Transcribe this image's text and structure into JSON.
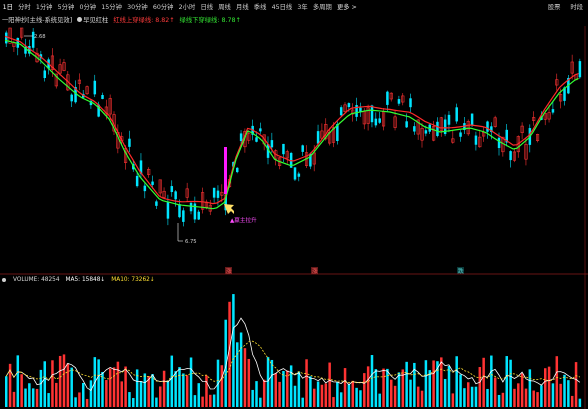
{
  "toolbar": {
    "items": [
      {
        "label": "1日"
      },
      {
        "label": "分时"
      },
      {
        "label": "1分钟"
      },
      {
        "label": "5分钟"
      },
      {
        "label": "0分钟"
      },
      {
        "label": "15分钟"
      },
      {
        "label": "30分钟"
      },
      {
        "label": "60分钟"
      },
      {
        "label": "2小时"
      },
      {
        "label": "日线"
      },
      {
        "label": "周线"
      },
      {
        "label": "月线"
      },
      {
        "label": "季线"
      },
      {
        "label": "45日线"
      },
      {
        "label": "3年"
      },
      {
        "label": "多周期"
      },
      {
        "label": "更多 >"
      }
    ],
    "right_items": [
      {
        "label": "股票"
      },
      {
        "label": "时段"
      }
    ]
  },
  "indicator": {
    "name": "一阳神抄[主线-系统见效]",
    "signal_name": "早见红柱",
    "red_text": "红线上穿绿线: 8.82↑",
    "green_text": "绿线下穿绿线: 8.78↑",
    "colors": {
      "red_line": "#ff2a2a",
      "green_line": "#32ff32",
      "text_red": "#ff3b3b",
      "text_green": "#33e633"
    }
  },
  "annotations": {
    "low_price": "6.75",
    "high_price": "2.68",
    "buy_label": "▲赢主拉升",
    "markers": [
      "涨",
      "涨",
      "跌"
    ]
  },
  "volume": {
    "label": "VOLUME: 48254",
    "ma5": "MA5: 15848↓",
    "ma10": "MA10: 73262↓",
    "colors": {
      "up": "#ff3333",
      "down": "#00e5ff",
      "ma5": "#ffffff",
      "ma10": "#ffe033"
    }
  }
}
